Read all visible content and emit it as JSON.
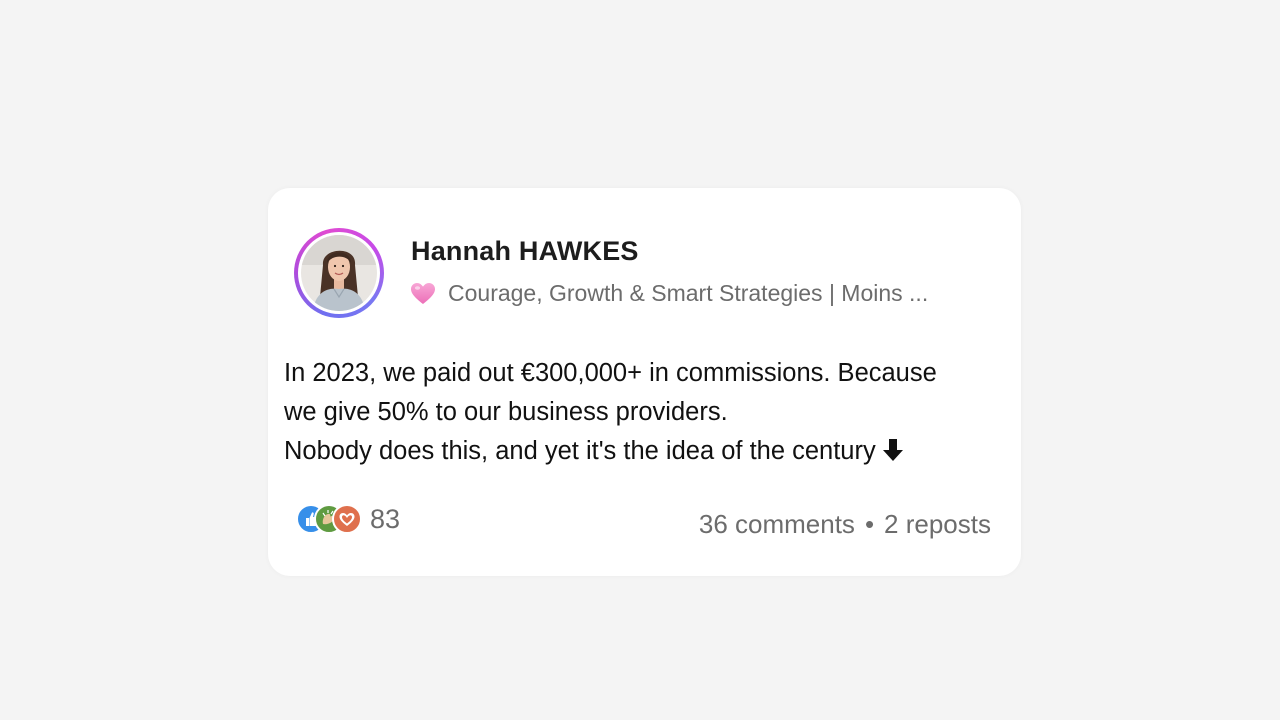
{
  "post": {
    "author": {
      "name": "Hannah HAWKES",
      "headline": "Courage, Growth & Smart Strategies | Moins ...",
      "headline_icon": "pink-heart-icon",
      "avatar": "profile-photo"
    },
    "body": {
      "line1": "In 2023, we paid out €300,000+ in commissions. Because",
      "line2": "we give 50% to our business providers.",
      "line3": "Nobody does this, and yet it's the idea of the century",
      "line3_icon": "down-arrow-icon"
    },
    "reactions": {
      "icons": [
        "like-icon",
        "celebrate-icon",
        "love-icon"
      ],
      "count": "83"
    },
    "stats": {
      "comments": "36 comments",
      "separator": "•",
      "reposts": "2 reposts"
    }
  },
  "colors": {
    "background": "#f4f4f4",
    "card": "#ffffff",
    "secondary_text": "#6c6c6c",
    "like_blue": "#378fe9",
    "celebrate_green": "#5f9b41",
    "love_red": "#df704d",
    "avatar_ring": "#b04bdc"
  }
}
